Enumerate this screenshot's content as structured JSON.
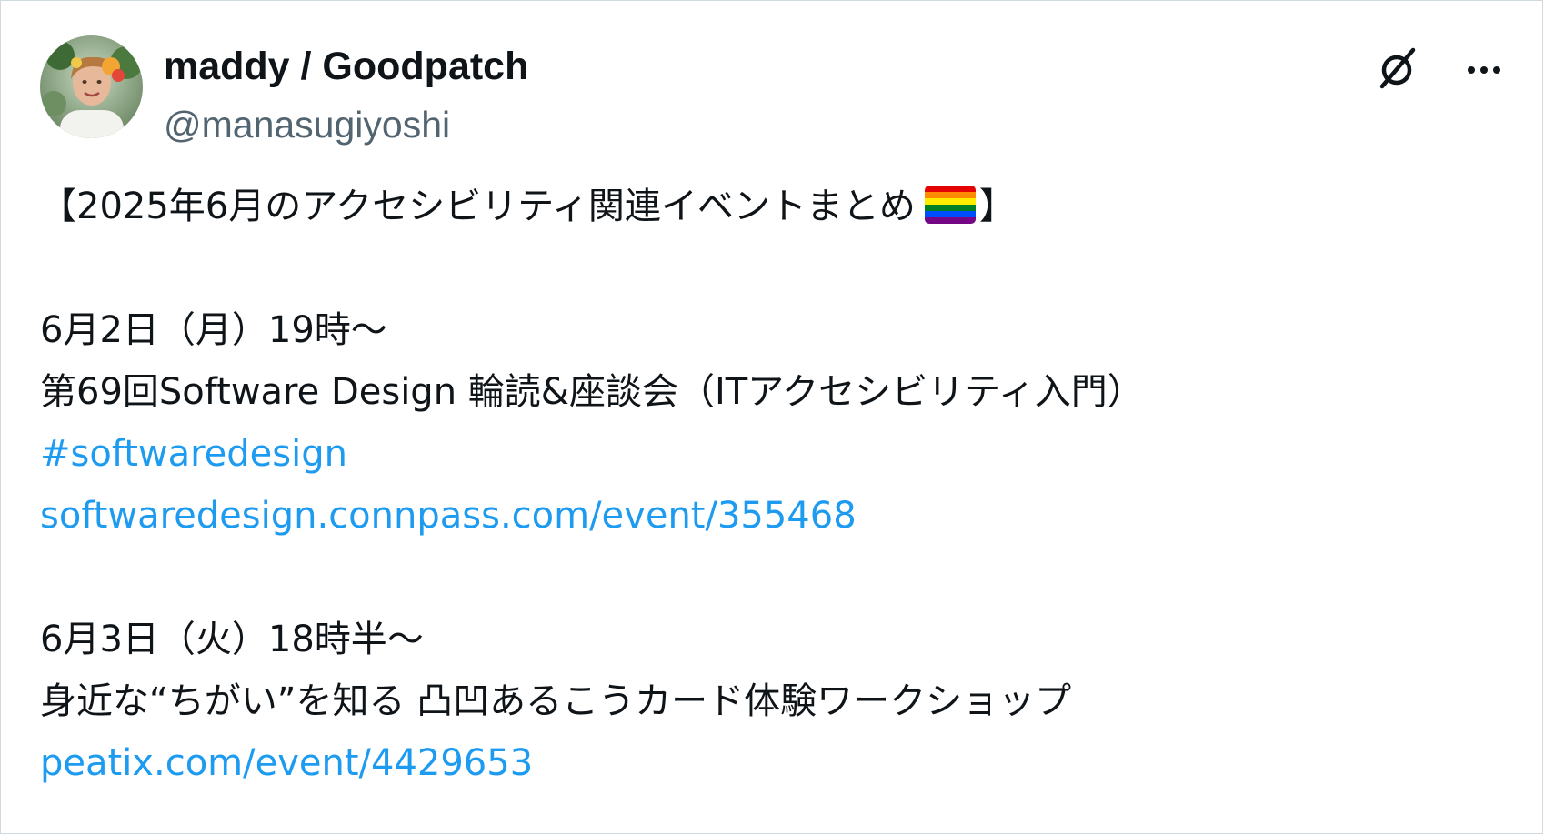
{
  "author": {
    "display_name": "maddy / Goodpatch",
    "handle": "@manasugiyoshi"
  },
  "icons": {
    "logo": "x-logo-icon",
    "more": "more-horizontal-icon",
    "flag": "rainbow-flag-icon"
  },
  "colors": {
    "text": "#0f1419",
    "secondary_text": "#536471",
    "link": "#1d9bf0",
    "border": "#cfd9de",
    "flag": [
      "#e40303",
      "#ff8c00",
      "#ffed00",
      "#008026",
      "#004dff",
      "#750787"
    ]
  },
  "tweet": {
    "title_open": "【2025年6月のアクセシビリティ関連イベントまとめ",
    "title_close": "】",
    "event1": {
      "date": "6月2日（月）19時〜",
      "name": "第69回Software Design 輪読&座談会（ITアクセシビリティ入門）",
      "hashtag": "#softwaredesign",
      "link": "softwaredesign.connpass.com/event/355468"
    },
    "event2": {
      "date": "6月3日（火）18時半〜",
      "name": "身近な“ちがい”を知る 凸凹あるこうカード体験ワークショップ",
      "link": "peatix.com/event/4429653"
    }
  }
}
